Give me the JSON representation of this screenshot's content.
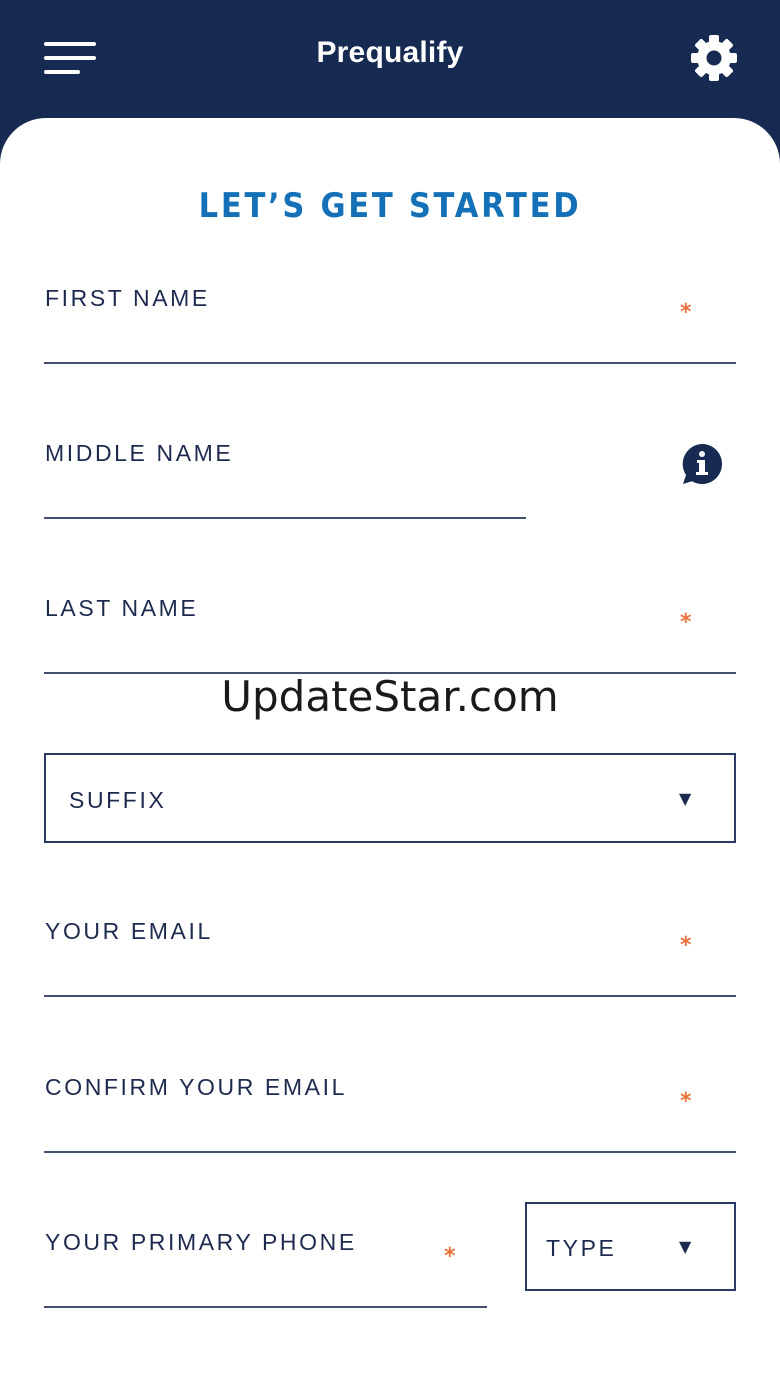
{
  "header": {
    "title": "Prequalify",
    "menu_icon": "hamburger-menu-icon",
    "settings_icon": "gear-icon",
    "background_color": "#172a52"
  },
  "form": {
    "heading": "LET’S GET STARTED",
    "heading_color": "#1471b8",
    "required_marker": "*",
    "required_color": "#e8733a",
    "fields": {
      "first_name": {
        "label": "FIRST NAME",
        "required": true
      },
      "middle_name": {
        "label": "MIDDLE NAME",
        "required": false,
        "icon": "info-icon"
      },
      "last_name": {
        "label": "LAST NAME",
        "required": true
      },
      "suffix": {
        "label": "SUFFIX"
      },
      "email": {
        "label": "YOUR EMAIL",
        "required": true
      },
      "confirm_email": {
        "label": "CONFIRM YOUR EMAIL",
        "required": true
      },
      "primary_phone": {
        "label": "YOUR PRIMARY PHONE",
        "required": true
      },
      "phone_type": {
        "label": "TYPE"
      }
    },
    "caret_glyph": "▼"
  },
  "watermark": "UpdateStar.com"
}
